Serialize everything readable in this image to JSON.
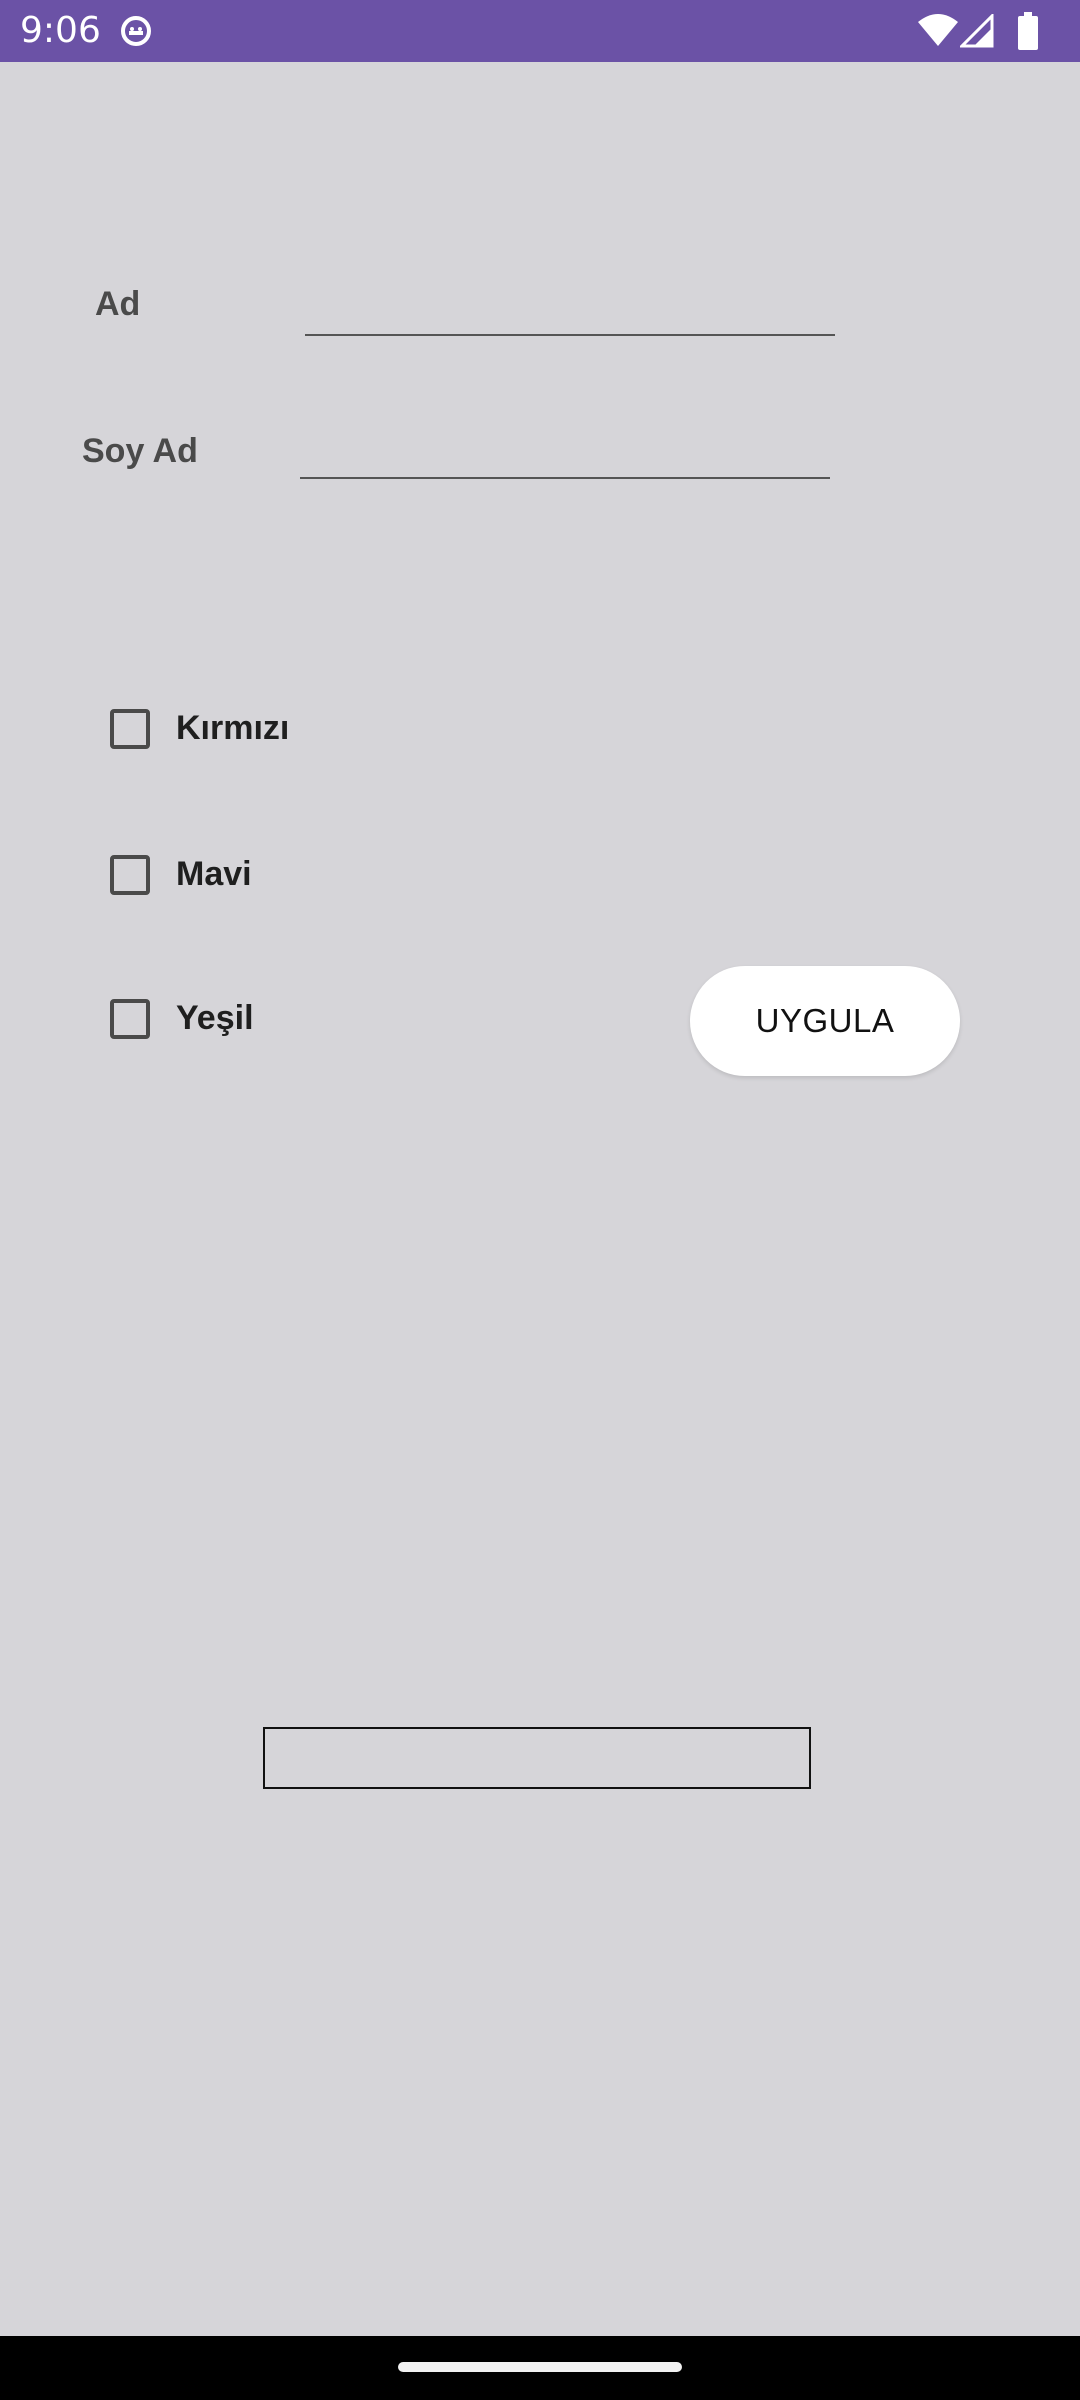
{
  "status_bar": {
    "time": "9:06",
    "app_icon": "android-robot-icon",
    "wifi_icon": "wifi-icon",
    "signal_icon": "cellular-signal-icon",
    "battery_icon": "battery-icon",
    "color": "#6b52a6"
  },
  "form": {
    "first_name_label": "Ad",
    "first_name_value": "",
    "last_name_label": "Soy Ad",
    "last_name_value": ""
  },
  "colors_options": [
    {
      "label": "Kırmızı",
      "checked": false
    },
    {
      "label": "Mavi",
      "checked": false
    },
    {
      "label": "Yeşil",
      "checked": false
    }
  ],
  "apply_button": {
    "label": "UYGULA"
  },
  "output": {
    "text": ""
  },
  "theme": {
    "background": "#d6d5d9",
    "button_bg": "#ffffff"
  }
}
